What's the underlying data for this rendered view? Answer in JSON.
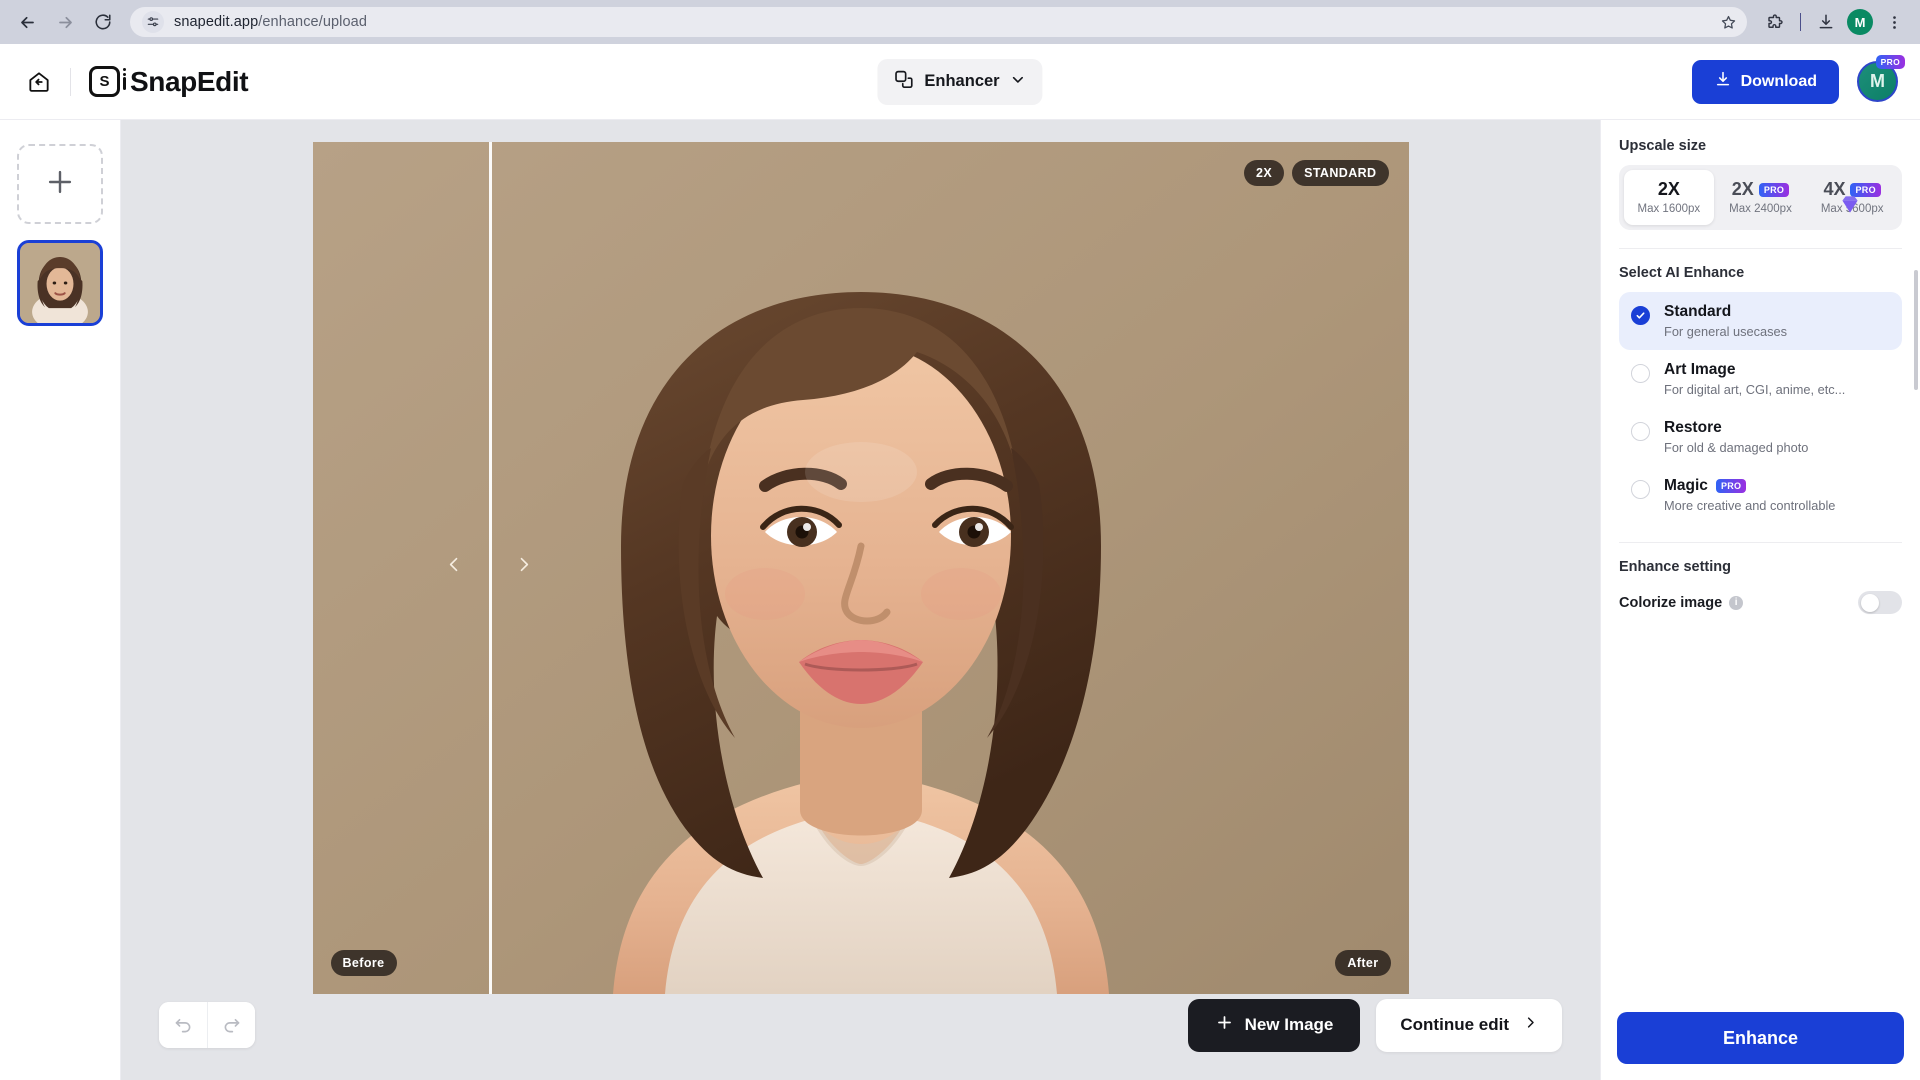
{
  "browser": {
    "back_icon": "arrow-left-icon",
    "forward_icon": "arrow-right-icon",
    "reload_icon": "reload-icon",
    "site_settings_icon": "page-settings-icon",
    "url_host": "snapedit.app",
    "url_path": "/enhance/upload",
    "bookmark_icon": "star-icon",
    "extensions_icon": "puzzle-icon",
    "downloads_icon": "download-tray-icon",
    "profile_initial": "M",
    "menu_icon": "kebab-menu-icon"
  },
  "app_header": {
    "home_icon": "home-back-icon",
    "brand_mark_letter": "S",
    "brand_name": "SnapEdit",
    "mode": {
      "icon": "enhancer-icon",
      "label": "Enhancer",
      "chevron": "chevron-down-icon"
    },
    "download_label": "Download",
    "download_icon": "download-icon",
    "avatar_initial": "M",
    "avatar_badge": "PRO"
  },
  "rail": {
    "add_icon": "plus-icon",
    "add_tooltip": "Add image",
    "thumbnails": [
      {
        "name": "portrait-thumbnail",
        "selected": true
      }
    ]
  },
  "canvas": {
    "badges": {
      "scale": "2X",
      "mode": "STANDARD"
    },
    "before_label": "Before",
    "after_label": "After",
    "slider_left_icon": "chevron-left-icon",
    "slider_right_icon": "chevron-right-icon",
    "undo_icon": "undo-icon",
    "redo_icon": "redo-icon",
    "new_image_label": "New Image",
    "new_image_icon": "plus-icon",
    "continue_edit_label": "Continue edit",
    "continue_edit_icon": "chevron-right-icon"
  },
  "panel": {
    "upscale_title": "Upscale size",
    "upscale_options": [
      {
        "factor": "2X",
        "max": "Max 1600px",
        "pro": false,
        "active": true
      },
      {
        "factor": "2X",
        "max": "Max 2400px",
        "pro": true,
        "active": false
      },
      {
        "factor": "4X",
        "max": "Max 5600px",
        "pro": true,
        "active": false
      }
    ],
    "pro_badge": "PRO",
    "enhance_title": "Select AI Enhance",
    "enhance_options": [
      {
        "name": "Standard",
        "desc": "For general usecases",
        "selected": true,
        "pro": false
      },
      {
        "name": "Art Image",
        "desc": "For digital art, CGI, anime, etc...",
        "selected": false,
        "pro": false
      },
      {
        "name": "Restore",
        "desc": "For old & damaged photo",
        "selected": false,
        "pro": false
      },
      {
        "name": "Magic",
        "desc": "More creative and controllable",
        "selected": false,
        "pro": true
      }
    ],
    "setting_title": "Enhance setting",
    "colorize_label": "Colorize image",
    "colorize_info_icon": "info-icon",
    "colorize_enabled": false,
    "enhance_button": "Enhance"
  },
  "colors": {
    "accent_blue": "#1a3fd6",
    "panel_bg": "#ffffff",
    "canvas_bg": "#e3e4e8",
    "dark_button": "#1b1c22",
    "photo_bg": "#b6a084"
  }
}
